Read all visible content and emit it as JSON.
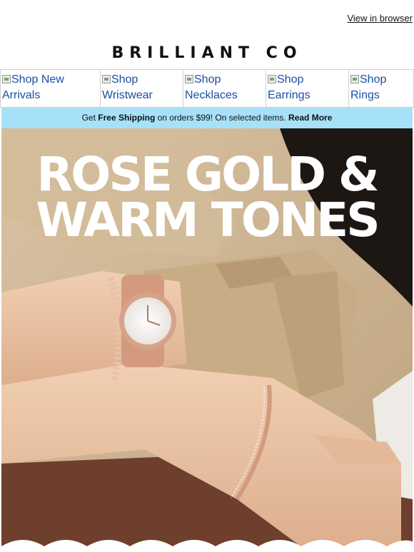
{
  "header": {
    "view_in_browser": "View in browser"
  },
  "brand": {
    "logo_text": "BRILLIANT CO"
  },
  "nav": {
    "items": [
      {
        "label": "Shop New Arrivals"
      },
      {
        "label": "Shop Wristwear"
      },
      {
        "label": "Shop Necklaces"
      },
      {
        "label": "Shop Earrings"
      },
      {
        "label": "Shop Rings"
      }
    ]
  },
  "shipping_banner": {
    "prefix": "Get ",
    "highlight": "Free Shipping",
    "middle": " on orders $99! On selected items. ",
    "link": "Read More",
    "bg_color": "#a7e1f8"
  },
  "hero": {
    "line1": "ROSE GOLD &",
    "line2": "WARM TONES"
  },
  "colors": {
    "coat": "#cdb391",
    "skin": "#ecc6a8",
    "rose_gold": "#d49a7e",
    "leather": "#6e3f2c"
  }
}
